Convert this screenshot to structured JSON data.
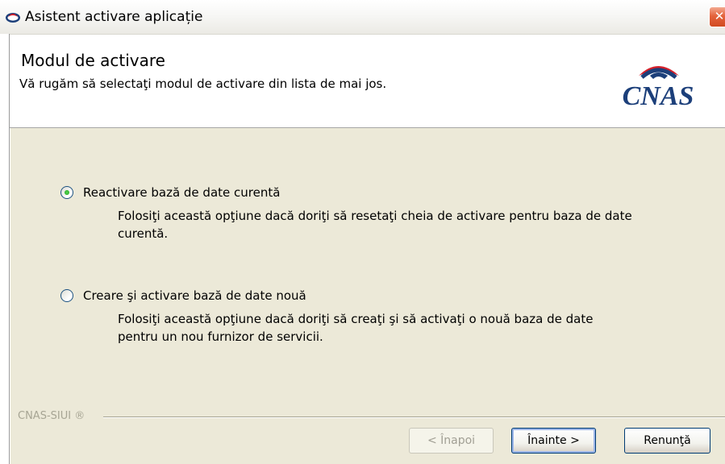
{
  "window": {
    "title": "Asistent activare aplicație",
    "close_symbol": "✕"
  },
  "header": {
    "title": "Modul de activare",
    "subtitle": "Vă rugăm să selectaţi modul de activare din lista de mai jos.",
    "logo_text": "CNAS"
  },
  "options": [
    {
      "label": "Reactivare bază de date curentă",
      "description": "Folosiţi această opţiune dacă doriţi să resetaţi cheia de activare pentru baza de date curentă.",
      "selected": true
    },
    {
      "label": "Creare şi activare bază de date nouă",
      "description": "Folosiţi această opţiune dacă doriţi să creaţi şi să activaţi o nouă baza de date pentru un nou furnizor de servicii.",
      "selected": false
    }
  ],
  "footer": {
    "brand": "CNAS-SIUI ®",
    "back_label": "< Înapoi",
    "next_label": "Înainte >",
    "cancel_label": "Renunţă"
  },
  "colors": {
    "content_bg": "#ece9d8",
    "radio_selected": "#21a121",
    "logo_blue": "#1c3f7a",
    "logo_red": "#d6202a"
  }
}
